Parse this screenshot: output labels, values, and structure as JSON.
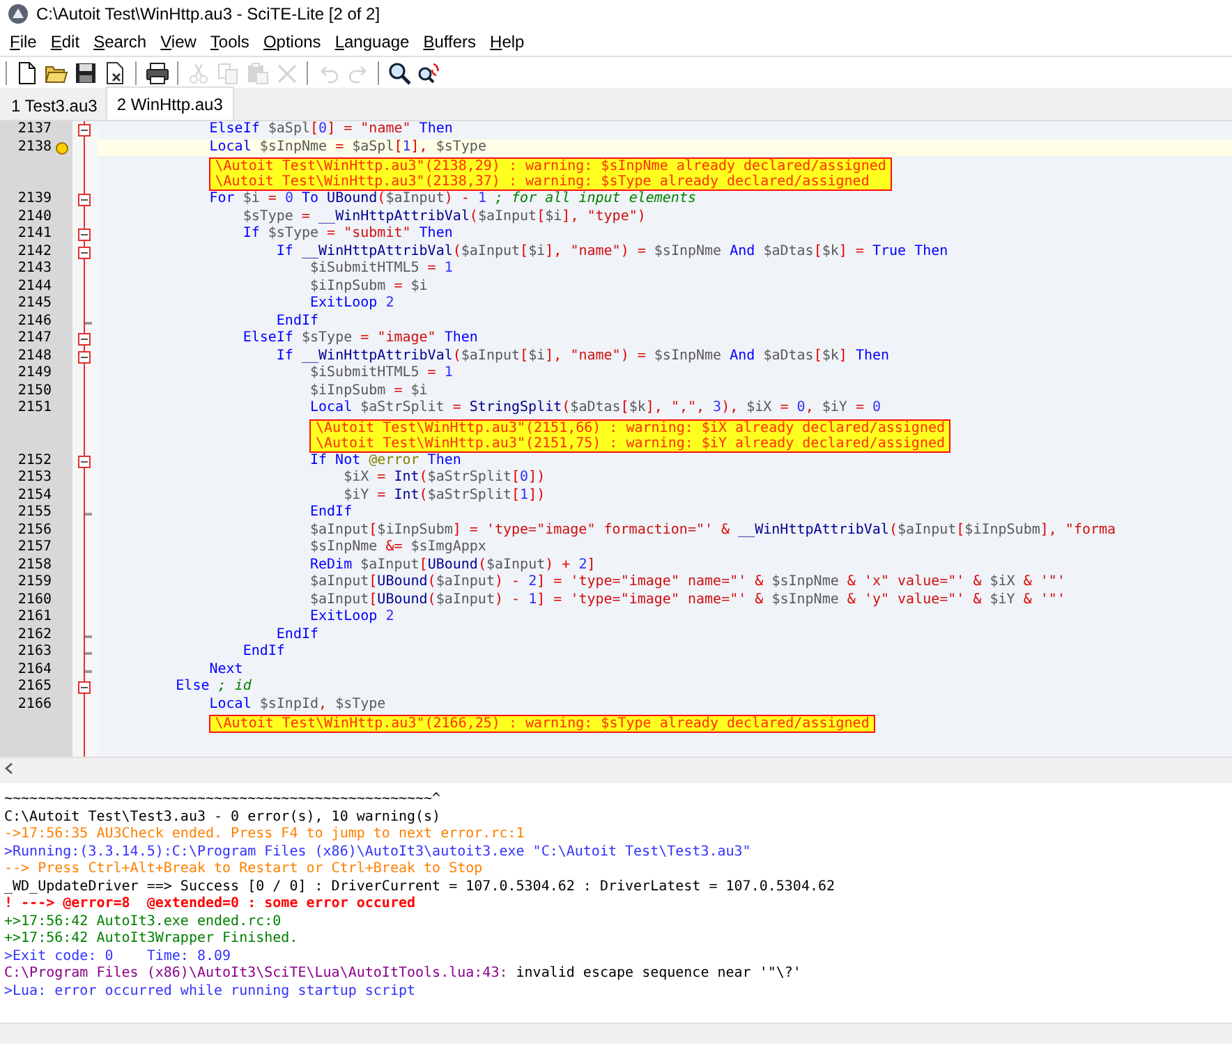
{
  "window": {
    "title": "C:\\Autoit Test\\WinHttp.au3 - SciTE-Lite [2 of 2]"
  },
  "menu": [
    "File",
    "Edit",
    "Search",
    "View",
    "Tools",
    "Options",
    "Language",
    "Buffers",
    "Help"
  ],
  "toolbar": [
    [
      {
        "kind": "new",
        "disabled": false
      },
      {
        "kind": "open",
        "disabled": false
      },
      {
        "kind": "save",
        "disabled": false
      },
      {
        "kind": "close",
        "disabled": false
      }
    ],
    [
      {
        "kind": "print",
        "disabled": false
      }
    ],
    [
      {
        "kind": "cut",
        "disabled": true
      },
      {
        "kind": "copy",
        "disabled": true
      },
      {
        "kind": "paste",
        "disabled": true
      },
      {
        "kind": "delete",
        "disabled": true
      }
    ],
    [
      {
        "kind": "undo",
        "disabled": true
      },
      {
        "kind": "redo",
        "disabled": true
      }
    ],
    [
      {
        "kind": "find",
        "disabled": false
      },
      {
        "kind": "replace",
        "disabled": false
      }
    ]
  ],
  "tabs": [
    {
      "label": "1 Test3.au3",
      "selected": false
    },
    {
      "label": "2 WinHttp.au3",
      "selected": true
    }
  ],
  "editor": {
    "lines": [
      {
        "number": "2137",
        "fold_start": true,
        "fold_end": false,
        "current": false,
        "bookmark": false,
        "tokens": [
          {
            "kind": "kw",
            "text": "            ElseIf "
          },
          {
            "kind": "var",
            "text": "$aSpl"
          },
          {
            "kind": "op",
            "text": "["
          },
          {
            "kind": "num",
            "text": "0"
          },
          {
            "kind": "op",
            "text": "] = "
          },
          {
            "kind": "str",
            "text": "\"name\""
          },
          {
            "kind": "kw",
            "text": " Then"
          }
        ]
      },
      {
        "number": "2138",
        "fold_start": false,
        "fold_end": false,
        "current": true,
        "bookmark": true,
        "tokens": [
          {
            "kind": "kw",
            "text": "            Local "
          },
          {
            "kind": "var",
            "text": "$sInpNme "
          },
          {
            "kind": "op",
            "text": "= "
          },
          {
            "kind": "var",
            "text": "$aSpl"
          },
          {
            "kind": "op",
            "text": "["
          },
          {
            "kind": "num",
            "text": "1"
          },
          {
            "kind": "op",
            "text": "], "
          },
          {
            "kind": "var",
            "text": "$sType"
          }
        ],
        "annotations": [
          "\\Autoit Test\\WinHttp.au3\"(2138,29) : warning: $sInpNme already declared/assigned",
          "\\Autoit Test\\WinHttp.au3\"(2138,37) : warning: $sType already declared/assigned"
        ]
      },
      {
        "number": "2139",
        "fold_start": true,
        "fold_end": false,
        "current": false,
        "bookmark": false,
        "tokens": [
          {
            "kind": "kw",
            "text": "            For "
          },
          {
            "kind": "var",
            "text": "$i "
          },
          {
            "kind": "op",
            "text": "= "
          },
          {
            "kind": "num",
            "text": "0 "
          },
          {
            "kind": "kw",
            "text": "To "
          },
          {
            "kind": "fn",
            "text": "UBound"
          },
          {
            "kind": "op",
            "text": "("
          },
          {
            "kind": "var",
            "text": "$aInput"
          },
          {
            "kind": "op",
            "text": ") - "
          },
          {
            "kind": "num",
            "text": "1 "
          },
          {
            "kind": "com",
            "text": "; for all input elements"
          }
        ]
      },
      {
        "number": "2140",
        "fold_start": false,
        "fold_end": false,
        "current": false,
        "bookmark": false,
        "tokens": [
          {
            "kind": "var",
            "text": "                $sType "
          },
          {
            "kind": "op",
            "text": "= "
          },
          {
            "kind": "fn",
            "text": "__WinHttpAttribVal"
          },
          {
            "kind": "op",
            "text": "("
          },
          {
            "kind": "var",
            "text": "$aInput"
          },
          {
            "kind": "op",
            "text": "["
          },
          {
            "kind": "var",
            "text": "$i"
          },
          {
            "kind": "op",
            "text": "], "
          },
          {
            "kind": "str",
            "text": "\"type\""
          },
          {
            "kind": "op",
            "text": ")"
          }
        ]
      },
      {
        "number": "2141",
        "fold_start": true,
        "fold_end": false,
        "current": false,
        "bookmark": false,
        "tokens": [
          {
            "kind": "kw",
            "text": "                If "
          },
          {
            "kind": "var",
            "text": "$sType "
          },
          {
            "kind": "op",
            "text": "= "
          },
          {
            "kind": "str",
            "text": "\"submit\" "
          },
          {
            "kind": "kw",
            "text": "Then"
          }
        ]
      },
      {
        "number": "2142",
        "fold_start": true,
        "fold_end": false,
        "current": false,
        "bookmark": false,
        "tokens": [
          {
            "kind": "kw",
            "text": "                    If "
          },
          {
            "kind": "fn",
            "text": "__WinHttpAttribVal"
          },
          {
            "kind": "op",
            "text": "("
          },
          {
            "kind": "var",
            "text": "$aInput"
          },
          {
            "kind": "op",
            "text": "["
          },
          {
            "kind": "var",
            "text": "$i"
          },
          {
            "kind": "op",
            "text": "], "
          },
          {
            "kind": "str",
            "text": "\"name\""
          },
          {
            "kind": "op",
            "text": ") = "
          },
          {
            "kind": "var",
            "text": "$sInpNme "
          },
          {
            "kind": "kw",
            "text": "And "
          },
          {
            "kind": "var",
            "text": "$aDtas"
          },
          {
            "kind": "op",
            "text": "["
          },
          {
            "kind": "var",
            "text": "$k"
          },
          {
            "kind": "op",
            "text": "] = "
          },
          {
            "kind": "kw",
            "text": "True Then"
          }
        ]
      },
      {
        "number": "2143",
        "fold_start": false,
        "fold_end": false,
        "current": false,
        "bookmark": false,
        "tokens": [
          {
            "kind": "var",
            "text": "                        $iSubmitHTML5 "
          },
          {
            "kind": "op",
            "text": "= "
          },
          {
            "kind": "num",
            "text": "1"
          }
        ]
      },
      {
        "number": "2144",
        "fold_start": false,
        "fold_end": false,
        "current": false,
        "bookmark": false,
        "tokens": [
          {
            "kind": "var",
            "text": "                        $iInpSubm "
          },
          {
            "kind": "op",
            "text": "= "
          },
          {
            "kind": "var",
            "text": "$i"
          }
        ]
      },
      {
        "number": "2145",
        "fold_start": false,
        "fold_end": false,
        "current": false,
        "bookmark": false,
        "tokens": [
          {
            "kind": "kw",
            "text": "                        ExitLoop "
          },
          {
            "kind": "num",
            "text": "2"
          }
        ]
      },
      {
        "number": "2146",
        "fold_start": false,
        "fold_end": true,
        "current": false,
        "bookmark": false,
        "tokens": [
          {
            "kind": "kw",
            "text": "                    EndIf"
          }
        ]
      },
      {
        "number": "2147",
        "fold_start": true,
        "fold_end": false,
        "current": false,
        "bookmark": false,
        "tokens": [
          {
            "kind": "kw",
            "text": "                ElseIf "
          },
          {
            "kind": "var",
            "text": "$sType "
          },
          {
            "kind": "op",
            "text": "= "
          },
          {
            "kind": "str",
            "text": "\"image\" "
          },
          {
            "kind": "kw",
            "text": "Then"
          }
        ]
      },
      {
        "number": "2148",
        "fold_start": true,
        "fold_end": false,
        "current": false,
        "bookmark": false,
        "tokens": [
          {
            "kind": "kw",
            "text": "                    If "
          },
          {
            "kind": "fn",
            "text": "__WinHttpAttribVal"
          },
          {
            "kind": "op",
            "text": "("
          },
          {
            "kind": "var",
            "text": "$aInput"
          },
          {
            "kind": "op",
            "text": "["
          },
          {
            "kind": "var",
            "text": "$i"
          },
          {
            "kind": "op",
            "text": "], "
          },
          {
            "kind": "str",
            "text": "\"name\""
          },
          {
            "kind": "op",
            "text": ") = "
          },
          {
            "kind": "var",
            "text": "$sInpNme "
          },
          {
            "kind": "kw",
            "text": "And "
          },
          {
            "kind": "var",
            "text": "$aDtas"
          },
          {
            "kind": "op",
            "text": "["
          },
          {
            "kind": "var",
            "text": "$k"
          },
          {
            "kind": "op",
            "text": "] "
          },
          {
            "kind": "kw",
            "text": "Then"
          }
        ]
      },
      {
        "number": "2149",
        "fold_start": false,
        "fold_end": false,
        "current": false,
        "bookmark": false,
        "tokens": [
          {
            "kind": "var",
            "text": "                        $iSubmitHTML5 "
          },
          {
            "kind": "op",
            "text": "= "
          },
          {
            "kind": "num",
            "text": "1"
          }
        ]
      },
      {
        "number": "2150",
        "fold_start": false,
        "fold_end": false,
        "current": false,
        "bookmark": false,
        "tokens": [
          {
            "kind": "var",
            "text": "                        $iInpSubm "
          },
          {
            "kind": "op",
            "text": "= "
          },
          {
            "kind": "var",
            "text": "$i"
          }
        ]
      },
      {
        "number": "2151",
        "fold_start": false,
        "fold_end": false,
        "current": false,
        "bookmark": false,
        "tokens": [
          {
            "kind": "kw",
            "text": "                        Local "
          },
          {
            "kind": "var",
            "text": "$aStrSplit "
          },
          {
            "kind": "op",
            "text": "= "
          },
          {
            "kind": "fn",
            "text": "StringSplit"
          },
          {
            "kind": "op",
            "text": "("
          },
          {
            "kind": "var",
            "text": "$aDtas"
          },
          {
            "kind": "op",
            "text": "["
          },
          {
            "kind": "var",
            "text": "$k"
          },
          {
            "kind": "op",
            "text": "], "
          },
          {
            "kind": "str",
            "text": "\",\""
          },
          {
            "kind": "op",
            "text": ", "
          },
          {
            "kind": "num",
            "text": "3"
          },
          {
            "kind": "op",
            "text": "), "
          },
          {
            "kind": "var",
            "text": "$iX "
          },
          {
            "kind": "op",
            "text": "= "
          },
          {
            "kind": "num",
            "text": "0"
          },
          {
            "kind": "op",
            "text": ", "
          },
          {
            "kind": "var",
            "text": "$iY "
          },
          {
            "kind": "op",
            "text": "= "
          },
          {
            "kind": "num",
            "text": "0"
          }
        ],
        "annotations": [
          "\\Autoit Test\\WinHttp.au3\"(2151,66) : warning: $iX already declared/assigned",
          "\\Autoit Test\\WinHttp.au3\"(2151,75) : warning: $iY already declared/assigned"
        ]
      },
      {
        "number": "2152",
        "fold_start": true,
        "fold_end": false,
        "current": false,
        "bookmark": false,
        "tokens": [
          {
            "kind": "kw",
            "text": "                        If Not "
          },
          {
            "kind": "macro",
            "text": "@error "
          },
          {
            "kind": "kw",
            "text": "Then"
          }
        ]
      },
      {
        "number": "2153",
        "fold_start": false,
        "fold_end": false,
        "current": false,
        "bookmark": false,
        "tokens": [
          {
            "kind": "var",
            "text": "                            $iX "
          },
          {
            "kind": "op",
            "text": "= "
          },
          {
            "kind": "fn",
            "text": "Int"
          },
          {
            "kind": "op",
            "text": "("
          },
          {
            "kind": "var",
            "text": "$aStrSplit"
          },
          {
            "kind": "op",
            "text": "["
          },
          {
            "kind": "num",
            "text": "0"
          },
          {
            "kind": "op",
            "text": "])"
          }
        ]
      },
      {
        "number": "2154",
        "fold_start": false,
        "fold_end": false,
        "current": false,
        "bookmark": false,
        "tokens": [
          {
            "kind": "var",
            "text": "                            $iY "
          },
          {
            "kind": "op",
            "text": "= "
          },
          {
            "kind": "fn",
            "text": "Int"
          },
          {
            "kind": "op",
            "text": "("
          },
          {
            "kind": "var",
            "text": "$aStrSplit"
          },
          {
            "kind": "op",
            "text": "["
          },
          {
            "kind": "num",
            "text": "1"
          },
          {
            "kind": "op",
            "text": "])"
          }
        ]
      },
      {
        "number": "2155",
        "fold_start": false,
        "fold_end": true,
        "current": false,
        "bookmark": false,
        "tokens": [
          {
            "kind": "kw",
            "text": "                        EndIf"
          }
        ]
      },
      {
        "number": "2156",
        "fold_start": false,
        "fold_end": false,
        "current": false,
        "bookmark": false,
        "tokens": [
          {
            "kind": "var",
            "text": "                        $aInput"
          },
          {
            "kind": "op",
            "text": "["
          },
          {
            "kind": "var",
            "text": "$iInpSubm"
          },
          {
            "kind": "op",
            "text": "] = "
          },
          {
            "kind": "str",
            "text": "'type=\"image\" formaction=\"' "
          },
          {
            "kind": "op",
            "text": "& "
          },
          {
            "kind": "fn",
            "text": "__WinHttpAttribVal"
          },
          {
            "kind": "op",
            "text": "("
          },
          {
            "kind": "var",
            "text": "$aInput"
          },
          {
            "kind": "op",
            "text": "["
          },
          {
            "kind": "var",
            "text": "$iInpSubm"
          },
          {
            "kind": "op",
            "text": "], "
          },
          {
            "kind": "str",
            "text": "\"forma"
          }
        ]
      },
      {
        "number": "2157",
        "fold_start": false,
        "fold_end": false,
        "current": false,
        "bookmark": false,
        "tokens": [
          {
            "kind": "var",
            "text": "                        $sInpNme "
          },
          {
            "kind": "op",
            "text": "&= "
          },
          {
            "kind": "var",
            "text": "$sImgAppx"
          }
        ]
      },
      {
        "number": "2158",
        "fold_start": false,
        "fold_end": false,
        "current": false,
        "bookmark": false,
        "tokens": [
          {
            "kind": "kw",
            "text": "                        ReDim "
          },
          {
            "kind": "var",
            "text": "$aInput"
          },
          {
            "kind": "op",
            "text": "["
          },
          {
            "kind": "fn",
            "text": "UBound"
          },
          {
            "kind": "op",
            "text": "("
          },
          {
            "kind": "var",
            "text": "$aInput"
          },
          {
            "kind": "op",
            "text": ") + "
          },
          {
            "kind": "num",
            "text": "2"
          },
          {
            "kind": "op",
            "text": "]"
          }
        ]
      },
      {
        "number": "2159",
        "fold_start": false,
        "fold_end": false,
        "current": false,
        "bookmark": false,
        "tokens": [
          {
            "kind": "var",
            "text": "                        $aInput"
          },
          {
            "kind": "op",
            "text": "["
          },
          {
            "kind": "fn",
            "text": "UBound"
          },
          {
            "kind": "op",
            "text": "("
          },
          {
            "kind": "var",
            "text": "$aInput"
          },
          {
            "kind": "op",
            "text": ") - "
          },
          {
            "kind": "num",
            "text": "2"
          },
          {
            "kind": "op",
            "text": "] = "
          },
          {
            "kind": "str",
            "text": "'type=\"image\" name=\"' "
          },
          {
            "kind": "op",
            "text": "& "
          },
          {
            "kind": "var",
            "text": "$sInpNme "
          },
          {
            "kind": "op",
            "text": "& "
          },
          {
            "kind": "str",
            "text": "'x\" value=\"' "
          },
          {
            "kind": "op",
            "text": "& "
          },
          {
            "kind": "var",
            "text": "$iX "
          },
          {
            "kind": "op",
            "text": "& "
          },
          {
            "kind": "str",
            "text": "'\"'"
          }
        ]
      },
      {
        "number": "2160",
        "fold_start": false,
        "fold_end": false,
        "current": false,
        "bookmark": false,
        "tokens": [
          {
            "kind": "var",
            "text": "                        $aInput"
          },
          {
            "kind": "op",
            "text": "["
          },
          {
            "kind": "fn",
            "text": "UBound"
          },
          {
            "kind": "op",
            "text": "("
          },
          {
            "kind": "var",
            "text": "$aInput"
          },
          {
            "kind": "op",
            "text": ") - "
          },
          {
            "kind": "num",
            "text": "1"
          },
          {
            "kind": "op",
            "text": "] = "
          },
          {
            "kind": "str",
            "text": "'type=\"image\" name=\"' "
          },
          {
            "kind": "op",
            "text": "& "
          },
          {
            "kind": "var",
            "text": "$sInpNme "
          },
          {
            "kind": "op",
            "text": "& "
          },
          {
            "kind": "str",
            "text": "'y\" value=\"' "
          },
          {
            "kind": "op",
            "text": "& "
          },
          {
            "kind": "var",
            "text": "$iY "
          },
          {
            "kind": "op",
            "text": "& "
          },
          {
            "kind": "str",
            "text": "'\"'"
          }
        ]
      },
      {
        "number": "2161",
        "fold_start": false,
        "fold_end": false,
        "current": false,
        "bookmark": false,
        "tokens": [
          {
            "kind": "kw",
            "text": "                        ExitLoop "
          },
          {
            "kind": "num",
            "text": "2"
          }
        ]
      },
      {
        "number": "2162",
        "fold_start": false,
        "fold_end": true,
        "current": false,
        "bookmark": false,
        "tokens": [
          {
            "kind": "kw",
            "text": "                    EndIf"
          }
        ]
      },
      {
        "number": "2163",
        "fold_start": false,
        "fold_end": true,
        "current": false,
        "bookmark": false,
        "tokens": [
          {
            "kind": "kw",
            "text": "                EndIf"
          }
        ]
      },
      {
        "number": "2164",
        "fold_start": false,
        "fold_end": true,
        "current": false,
        "bookmark": false,
        "tokens": [
          {
            "kind": "kw",
            "text": "            Next"
          }
        ]
      },
      {
        "number": "2165",
        "fold_start": true,
        "fold_end": false,
        "current": false,
        "bookmark": false,
        "tokens": [
          {
            "kind": "kw",
            "text": "        Else "
          },
          {
            "kind": "com",
            "text": "; id"
          }
        ]
      },
      {
        "number": "2166",
        "fold_start": false,
        "fold_end": false,
        "current": false,
        "bookmark": false,
        "tokens": [
          {
            "kind": "kw",
            "text": "            Local "
          },
          {
            "kind": "var",
            "text": "$sInpId"
          },
          {
            "kind": "op",
            "text": ", "
          },
          {
            "kind": "var",
            "text": "$sType"
          }
        ],
        "annotations": [
          "\\Autoit Test\\WinHttp.au3\"(2166,25) : warning: $sType already declared/assigned"
        ]
      }
    ]
  },
  "output": {
    "lines": [
      {
        "segments": [
          {
            "kind": "plain",
            "text": "~~~~~~~~~~~~~~~~~~~~~~~~~~~~~~~~~~~~~~~~~~~~~~~~~~~^"
          }
        ]
      },
      {
        "segments": [
          {
            "kind": "plain",
            "text": "C:\\Autoit Test\\Test3.au3 - 0 error(s), 10 warning(s)"
          }
        ]
      },
      {
        "segments": [
          {
            "kind": "warn",
            "text": "->17:56:35 AU3Check ended. Press F4 to jump to next error.rc:1"
          }
        ]
      },
      {
        "segments": [
          {
            "kind": "info",
            "text": ">Running:(3.3.14.5):C:\\Program Files (x86)\\AutoIt3\\autoit3.exe \"C:\\Autoit Test\\Test3.au3\""
          }
        ]
      },
      {
        "segments": [
          {
            "kind": "warn",
            "text": "--> Press Ctrl+Alt+Break to Restart or Ctrl+Break to Stop"
          }
        ]
      },
      {
        "segments": [
          {
            "kind": "plain",
            "text": "_WD_UpdateDriver ==> Success [0 / 0] : DriverCurrent = 107.0.5304.62 : DriverLatest = 107.0.5304.62"
          }
        ]
      },
      {
        "segments": [
          {
            "kind": "error",
            "text": "! ---> @error=8  @extended=0 : some error occured"
          }
        ]
      },
      {
        "segments": [
          {
            "kind": "ok",
            "text": "+>17:56:42 AutoIt3.exe ended.rc:0"
          }
        ]
      },
      {
        "segments": [
          {
            "kind": "ok",
            "text": "+>17:56:42 AutoIt3Wrapper Finished."
          }
        ]
      },
      {
        "segments": [
          {
            "kind": "info",
            "text": ">Exit code: 0    Time: 8.09"
          }
        ]
      },
      {
        "segments": [
          {
            "kind": "path",
            "text": "C:\\Program Files (x86)\\AutoIt3\\SciTE\\Lua\\AutoItTools.lua:43:"
          },
          {
            "kind": "plain",
            "text": " invalid escape sequence near '\"\\?'"
          }
        ]
      },
      {
        "segments": [
          {
            "kind": "info",
            "text": ">Lua: error occurred while running startup script"
          }
        ]
      }
    ]
  }
}
